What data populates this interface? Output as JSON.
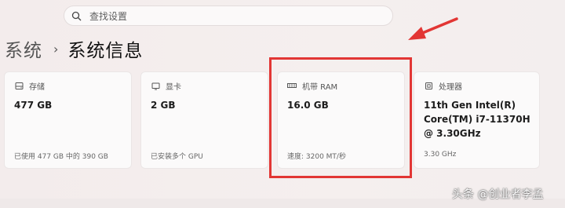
{
  "search": {
    "placeholder": "查找设置"
  },
  "breadcrumb": {
    "parent": "系统",
    "separator": "›",
    "current": "系统信息"
  },
  "cards": [
    {
      "label": "存储",
      "value": "477 GB",
      "sub": "已使用 477 GB 中的 390 GB",
      "icon": "storage-icon"
    },
    {
      "label": "显卡",
      "value": "2 GB",
      "sub": "已安装多个 GPU",
      "icon": "gpu-icon"
    },
    {
      "label": "机带 RAM",
      "value": "16.0 GB",
      "sub": "速度: 3200 MT/秒",
      "icon": "ram-icon"
    },
    {
      "label": "处理器",
      "value": "11th Gen Intel(R) Core(TM) i7-11370H @ 3.30GHz",
      "sub": "3.30 GHz",
      "icon": "cpu-icon"
    }
  ],
  "annotation": {
    "color": "#e23634"
  },
  "watermark": "头条 @创业者李孟"
}
